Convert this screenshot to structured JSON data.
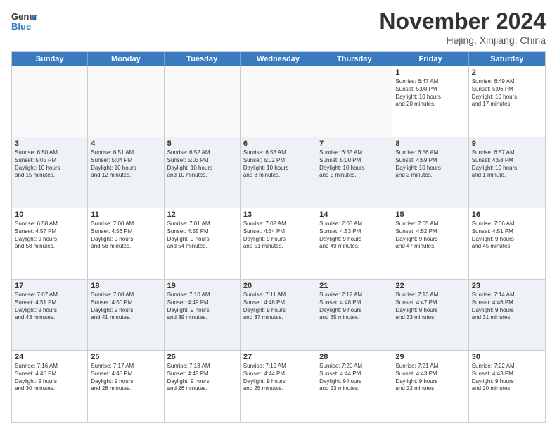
{
  "header": {
    "logo_line1": "General",
    "logo_line2": "Blue",
    "month": "November 2024",
    "location": "Hejing, Xinjiang, China"
  },
  "weekdays": [
    "Sunday",
    "Monday",
    "Tuesday",
    "Wednesday",
    "Thursday",
    "Friday",
    "Saturday"
  ],
  "weeks": [
    [
      {
        "day": "",
        "info": ""
      },
      {
        "day": "",
        "info": ""
      },
      {
        "day": "",
        "info": ""
      },
      {
        "day": "",
        "info": ""
      },
      {
        "day": "",
        "info": ""
      },
      {
        "day": "1",
        "info": "Sunrise: 6:47 AM\nSunset: 5:08 PM\nDaylight: 10 hours\nand 20 minutes."
      },
      {
        "day": "2",
        "info": "Sunrise: 6:49 AM\nSunset: 5:06 PM\nDaylight: 10 hours\nand 17 minutes."
      }
    ],
    [
      {
        "day": "3",
        "info": "Sunrise: 6:50 AM\nSunset: 5:05 PM\nDaylight: 10 hours\nand 15 minutes."
      },
      {
        "day": "4",
        "info": "Sunrise: 6:51 AM\nSunset: 5:04 PM\nDaylight: 10 hours\nand 12 minutes."
      },
      {
        "day": "5",
        "info": "Sunrise: 6:52 AM\nSunset: 5:03 PM\nDaylight: 10 hours\nand 10 minutes."
      },
      {
        "day": "6",
        "info": "Sunrise: 6:53 AM\nSunset: 5:02 PM\nDaylight: 10 hours\nand 8 minutes."
      },
      {
        "day": "7",
        "info": "Sunrise: 6:55 AM\nSunset: 5:00 PM\nDaylight: 10 hours\nand 5 minutes."
      },
      {
        "day": "8",
        "info": "Sunrise: 6:56 AM\nSunset: 4:59 PM\nDaylight: 10 hours\nand 3 minutes."
      },
      {
        "day": "9",
        "info": "Sunrise: 6:57 AM\nSunset: 4:58 PM\nDaylight: 10 hours\nand 1 minute."
      }
    ],
    [
      {
        "day": "10",
        "info": "Sunrise: 6:58 AM\nSunset: 4:57 PM\nDaylight: 9 hours\nand 58 minutes."
      },
      {
        "day": "11",
        "info": "Sunrise: 7:00 AM\nSunset: 4:56 PM\nDaylight: 9 hours\nand 56 minutes."
      },
      {
        "day": "12",
        "info": "Sunrise: 7:01 AM\nSunset: 4:55 PM\nDaylight: 9 hours\nand 54 minutes."
      },
      {
        "day": "13",
        "info": "Sunrise: 7:02 AM\nSunset: 4:54 PM\nDaylight: 9 hours\nand 51 minutes."
      },
      {
        "day": "14",
        "info": "Sunrise: 7:03 AM\nSunset: 4:53 PM\nDaylight: 9 hours\nand 49 minutes."
      },
      {
        "day": "15",
        "info": "Sunrise: 7:05 AM\nSunset: 4:52 PM\nDaylight: 9 hours\nand 47 minutes."
      },
      {
        "day": "16",
        "info": "Sunrise: 7:06 AM\nSunset: 4:51 PM\nDaylight: 9 hours\nand 45 minutes."
      }
    ],
    [
      {
        "day": "17",
        "info": "Sunrise: 7:07 AM\nSunset: 4:51 PM\nDaylight: 9 hours\nand 43 minutes."
      },
      {
        "day": "18",
        "info": "Sunrise: 7:08 AM\nSunset: 4:50 PM\nDaylight: 9 hours\nand 41 minutes."
      },
      {
        "day": "19",
        "info": "Sunrise: 7:10 AM\nSunset: 4:49 PM\nDaylight: 9 hours\nand 39 minutes."
      },
      {
        "day": "20",
        "info": "Sunrise: 7:11 AM\nSunset: 4:48 PM\nDaylight: 9 hours\nand 37 minutes."
      },
      {
        "day": "21",
        "info": "Sunrise: 7:12 AM\nSunset: 4:48 PM\nDaylight: 9 hours\nand 35 minutes."
      },
      {
        "day": "22",
        "info": "Sunrise: 7:13 AM\nSunset: 4:47 PM\nDaylight: 9 hours\nand 33 minutes."
      },
      {
        "day": "23",
        "info": "Sunrise: 7:14 AM\nSunset: 4:46 PM\nDaylight: 9 hours\nand 31 minutes."
      }
    ],
    [
      {
        "day": "24",
        "info": "Sunrise: 7:16 AM\nSunset: 4:46 PM\nDaylight: 9 hours\nand 30 minutes."
      },
      {
        "day": "25",
        "info": "Sunrise: 7:17 AM\nSunset: 4:45 PM\nDaylight: 9 hours\nand 28 minutes."
      },
      {
        "day": "26",
        "info": "Sunrise: 7:18 AM\nSunset: 4:45 PM\nDaylight: 9 hours\nand 26 minutes."
      },
      {
        "day": "27",
        "info": "Sunrise: 7:19 AM\nSunset: 4:44 PM\nDaylight: 9 hours\nand 25 minutes."
      },
      {
        "day": "28",
        "info": "Sunrise: 7:20 AM\nSunset: 4:44 PM\nDaylight: 9 hours\nand 23 minutes."
      },
      {
        "day": "29",
        "info": "Sunrise: 7:21 AM\nSunset: 4:43 PM\nDaylight: 9 hours\nand 22 minutes."
      },
      {
        "day": "30",
        "info": "Sunrise: 7:22 AM\nSunset: 4:43 PM\nDaylight: 9 hours\nand 20 minutes."
      }
    ]
  ]
}
